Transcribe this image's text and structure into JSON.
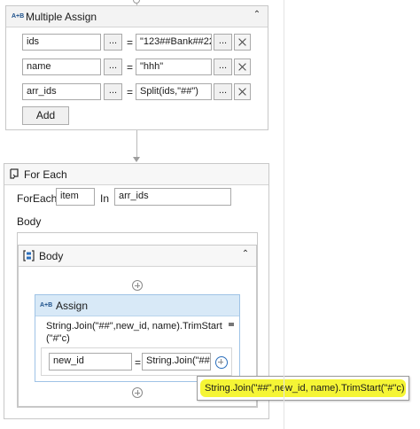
{
  "multiple_assign": {
    "title": "Multiple Assign",
    "icon_text": "A+B",
    "rows": [
      {
        "left": "ids",
        "right": "\"123##Bank##22"
      },
      {
        "left": "name",
        "right": "\"hhh\""
      },
      {
        "left": "arr_ids",
        "right": "Split(ids,\"##\")"
      }
    ],
    "dots_label": "...",
    "equals": "=",
    "add_label": "Add"
  },
  "for_each": {
    "title": "For Each",
    "foreach_label": "ForEach",
    "item_value": "item",
    "in_label": "In",
    "collection_value": "arr_ids",
    "body_label": "Body"
  },
  "body_sequence": {
    "title": "Body"
  },
  "assign": {
    "title": "Assign",
    "icon_text": "A+B",
    "expression_line1": "String.Join(\"##\",new_id, name).TrimStart",
    "expression_line2": "(\"#\"c)",
    "to_value": "new_id",
    "equals": "=",
    "value_value": "String.Join(\"##"
  },
  "tooltip": {
    "text": "String.Join(\"##\",new_id, name).TrimStart(\"#\"c)"
  },
  "colors": {
    "assign_header": "#d8e9f7",
    "highlight": "#f3f312"
  }
}
